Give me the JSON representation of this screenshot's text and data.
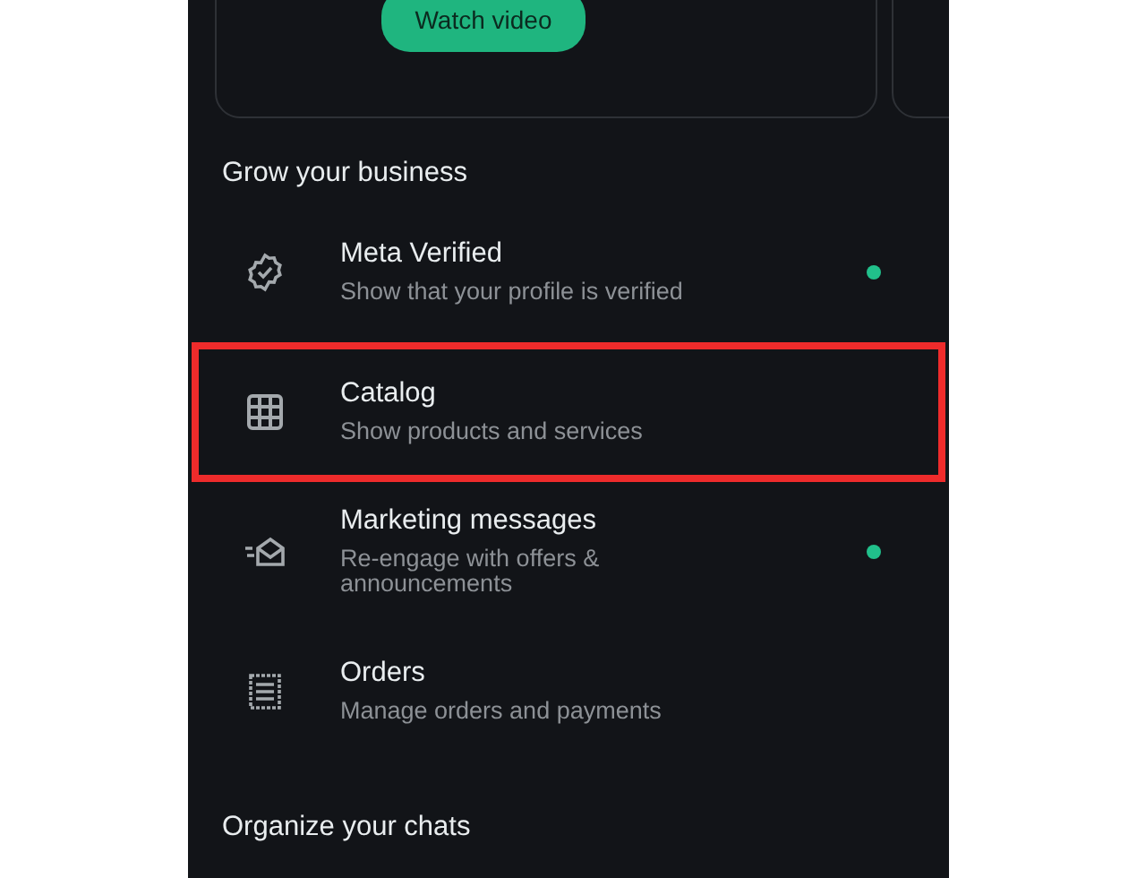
{
  "promo_card": {
    "button": "Watch video"
  },
  "sections": [
    {
      "heading": "Grow your business",
      "items": [
        {
          "title": "Meta Verified",
          "subtitle": "Show that your profile is verified",
          "new": true,
          "highlighted": false
        },
        {
          "title": "Catalog",
          "subtitle": "Show products and services",
          "new": false,
          "highlighted": true
        },
        {
          "title": "Marketing messages",
          "subtitle": "Re-engage with offers & announcements",
          "new": true,
          "highlighted": false
        },
        {
          "title": "Orders",
          "subtitle": "Manage orders and payments",
          "new": false,
          "highlighted": false
        }
      ]
    },
    {
      "heading": "Organize your chats"
    }
  ]
}
